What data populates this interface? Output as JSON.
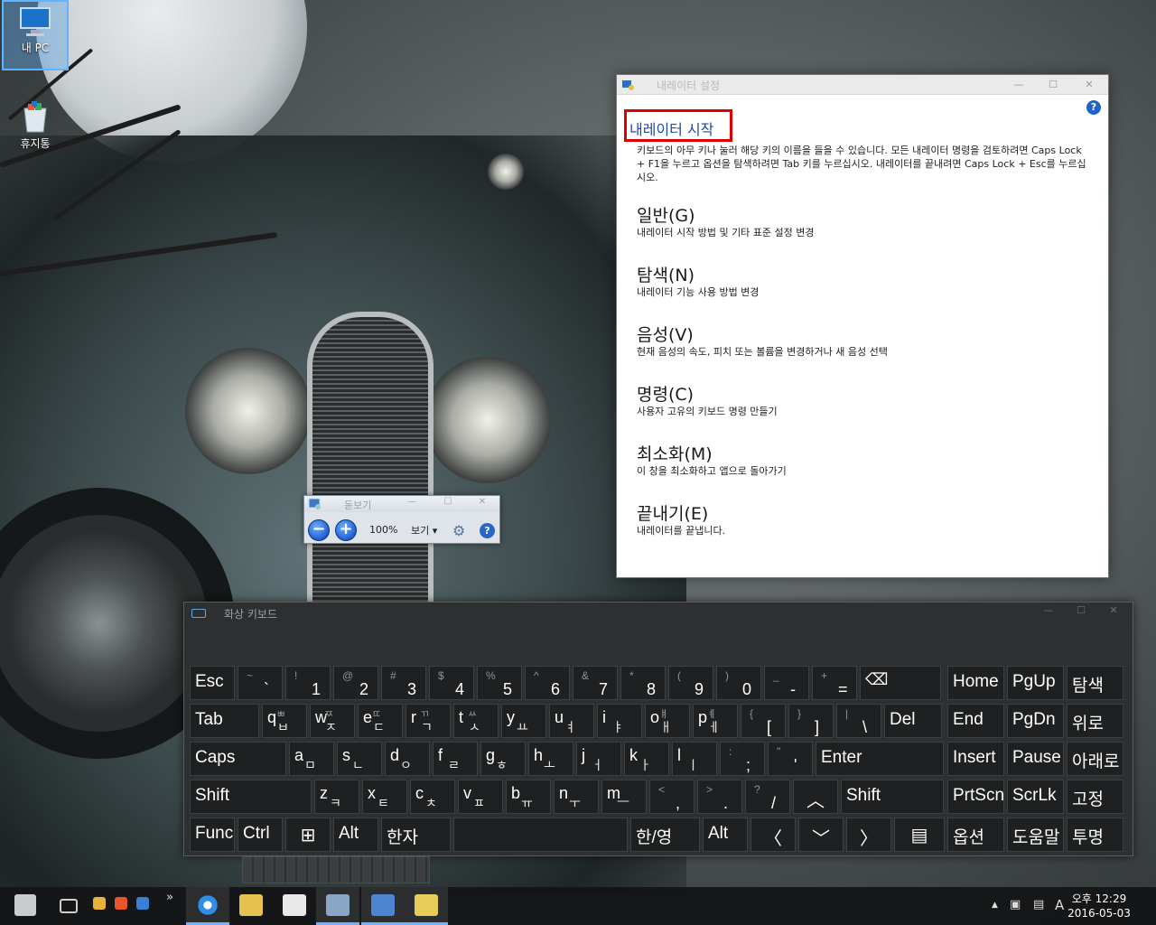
{
  "desktop": {
    "icons": [
      {
        "label": "내 PC",
        "icon": "monitor-icon",
        "selected": true
      },
      {
        "label": "휴지통",
        "icon": "recycle-bin-icon",
        "selected": false
      }
    ]
  },
  "narrator": {
    "title": "내레이터 설정",
    "start_link": "내레이터 시작",
    "description": "키보드의 아무 키나 눌러 해당 키의 이름을 들을 수 있습니다. 모든 내레이터 명령을 검토하려면 Caps Lock + F1을 누르고 옵션을 탐색하려면 Tab 키를 누르십시오. 내레이터를 끝내려면 Caps Lock + Esc를 누르십시오.",
    "sections": [
      {
        "heading": "일반(G)",
        "sub": "내레이터 시작 방법 및 기타 표준 설정 변경"
      },
      {
        "heading": "탐색(N)",
        "sub": "내레이터 기능 사용 방법 변경"
      },
      {
        "heading": "음성(V)",
        "sub": "현재 음성의 속도, 피치 또는 볼륨을 변경하거나 새 음성 선택"
      },
      {
        "heading": "명령(C)",
        "sub": "사용자 고유의 키보드 명령 만들기"
      },
      {
        "heading": "최소화(M)",
        "sub": "이 창을 최소화하고 앱으로 돌아가기"
      },
      {
        "heading": "끝내기(E)",
        "sub": "내레이터를 끝냅니다."
      }
    ],
    "help": "?",
    "minimize": "—",
    "maximize": "☐",
    "close": "✕"
  },
  "magnifier": {
    "title": "돋보기",
    "zoom_out": "−",
    "zoom_in": "+",
    "zoom_level": "100%",
    "view_label": "보기 ▾",
    "settings_icon": "gear-icon",
    "help": "?"
  },
  "keyboard": {
    "title": "화상 키보드",
    "rows": [
      [
        {
          "lb": "Esc",
          "w": 50
        },
        {
          "sh": "~",
          "ma": "`",
          "w": 50
        },
        {
          "sh": "!",
          "ma": "1",
          "w": 50
        },
        {
          "sh": "@",
          "ma": "2",
          "w": 50
        },
        {
          "sh": "#",
          "ma": "3",
          "w": 50
        },
        {
          "sh": "$",
          "ma": "4",
          "w": 50
        },
        {
          "sh": "%",
          "ma": "5",
          "w": 50
        },
        {
          "sh": "^",
          "ma": "6",
          "w": 50
        },
        {
          "sh": "&",
          "ma": "7",
          "w": 50
        },
        {
          "sh": "*",
          "ma": "8",
          "w": 50
        },
        {
          "sh": "(",
          "ma": "9",
          "w": 50
        },
        {
          "sh": ")",
          "ma": "0",
          "w": 50
        },
        {
          "sh": "_",
          "ma": "-",
          "w": 50
        },
        {
          "sh": "+",
          "ma": "=",
          "w": 50
        },
        {
          "lb": "⌫",
          "w": 88
        }
      ],
      [
        {
          "lb": "Tab",
          "w": 75
        },
        {
          "lb": "q",
          "ko": "ㅂ",
          "kos": "ㅃ",
          "w": 50
        },
        {
          "lb": "w",
          "ko": "ㅈ",
          "kos": "ㅉ",
          "w": 50
        },
        {
          "lb": "e",
          "ko": "ㄷ",
          "kos": "ㄸ",
          "w": 50
        },
        {
          "lb": "r",
          "ko": "ㄱ",
          "kos": "ㄲ",
          "w": 50
        },
        {
          "lb": "t",
          "ko": "ㅅ",
          "kos": "ㅆ",
          "w": 50
        },
        {
          "lb": "y",
          "ko": "ㅛ",
          "w": 50
        },
        {
          "lb": "u",
          "ko": "ㅕ",
          "w": 50
        },
        {
          "lb": "i",
          "ko": "ㅑ",
          "w": 50
        },
        {
          "lb": "o",
          "ko": "ㅐ",
          "kos": "ㅒ",
          "w": 50
        },
        {
          "lb": "p",
          "ko": "ㅔ",
          "kos": "ㅖ",
          "w": 50
        },
        {
          "sh": "{",
          "ma": "[",
          "w": 50
        },
        {
          "sh": "}",
          "ma": "]",
          "w": 50
        },
        {
          "sh": "|",
          "ma": "\\",
          "w": 50
        },
        {
          "lb": "Del",
          "w": 63
        }
      ],
      [
        {
          "lb": "Caps",
          "w": 104
        },
        {
          "lb": "a",
          "ko": "ㅁ",
          "w": 50
        },
        {
          "lb": "s",
          "ko": "ㄴ",
          "w": 50
        },
        {
          "lb": "d",
          "ko": "ㅇ",
          "w": 50
        },
        {
          "lb": "f",
          "ko": "ㄹ",
          "w": 50
        },
        {
          "lb": "g",
          "ko": "ㅎ",
          "w": 50
        },
        {
          "lb": "h",
          "ko": "ㅗ",
          "w": 50
        },
        {
          "lb": "j",
          "ko": "ㅓ",
          "w": 50
        },
        {
          "lb": "k",
          "ko": "ㅏ",
          "w": 50
        },
        {
          "lb": "l",
          "ko": "ㅣ",
          "w": 50
        },
        {
          "sh": ":",
          "ma": ";",
          "w": 50
        },
        {
          "sh": "\"",
          "ma": "'",
          "w": 50
        },
        {
          "lb": "Enter",
          "w": 137
        }
      ],
      [
        {
          "lb": "Shift",
          "w": 130
        },
        {
          "lb": "z",
          "ko": "ㅋ",
          "w": 50
        },
        {
          "lb": "x",
          "ko": "ㅌ",
          "w": 50
        },
        {
          "lb": "c",
          "ko": "ㅊ",
          "w": 50
        },
        {
          "lb": "v",
          "ko": "ㅍ",
          "w": 50
        },
        {
          "lb": "b",
          "ko": "ㅠ",
          "w": 50
        },
        {
          "lb": "n",
          "ko": "ㅜ",
          "w": 50
        },
        {
          "lb": "m",
          "ko": "—",
          "w": 50
        },
        {
          "sh": "<",
          "ma": ",",
          "w": 50
        },
        {
          "sh": ">",
          "ma": ".",
          "w": 50
        },
        {
          "sh": "?",
          "ma": "/",
          "w": 50
        },
        {
          "ctr": "︿",
          "w": 50
        },
        {
          "lb": "Shift",
          "w": 110
        }
      ],
      [
        {
          "lb": "Func",
          "w": 50
        },
        {
          "lb": "Ctrl",
          "w": 50
        },
        {
          "ctr": "⊞",
          "w": 50
        },
        {
          "lb": "Alt",
          "w": 50
        },
        {
          "lb": "한자",
          "w": 75
        },
        {
          "lb": "",
          "w": 185
        },
        {
          "lb": "한/영",
          "w": 75
        },
        {
          "lb": "Alt",
          "w": 50
        },
        {
          "ctr": "〈",
          "w": 50
        },
        {
          "ctr": "﹀",
          "w": 50
        },
        {
          "ctr": "〉",
          "w": 50
        },
        {
          "ctr": "▤",
          "w": 56
        }
      ]
    ],
    "side": [
      [
        "Home",
        "PgUp",
        "탐색"
      ],
      [
        "End",
        "PgDn",
        "위로"
      ],
      [
        "Insert",
        "Pause",
        "아래로"
      ],
      [
        "PrtScn",
        "ScrLk",
        "고정"
      ],
      [
        "옵션",
        "도움말",
        "투명"
      ]
    ]
  },
  "taskbar": {
    "clock_time": "오후 12:29",
    "clock_date": "2016-05-03",
    "ime": "A",
    "overflow": "»",
    "tray_up": "▲"
  }
}
